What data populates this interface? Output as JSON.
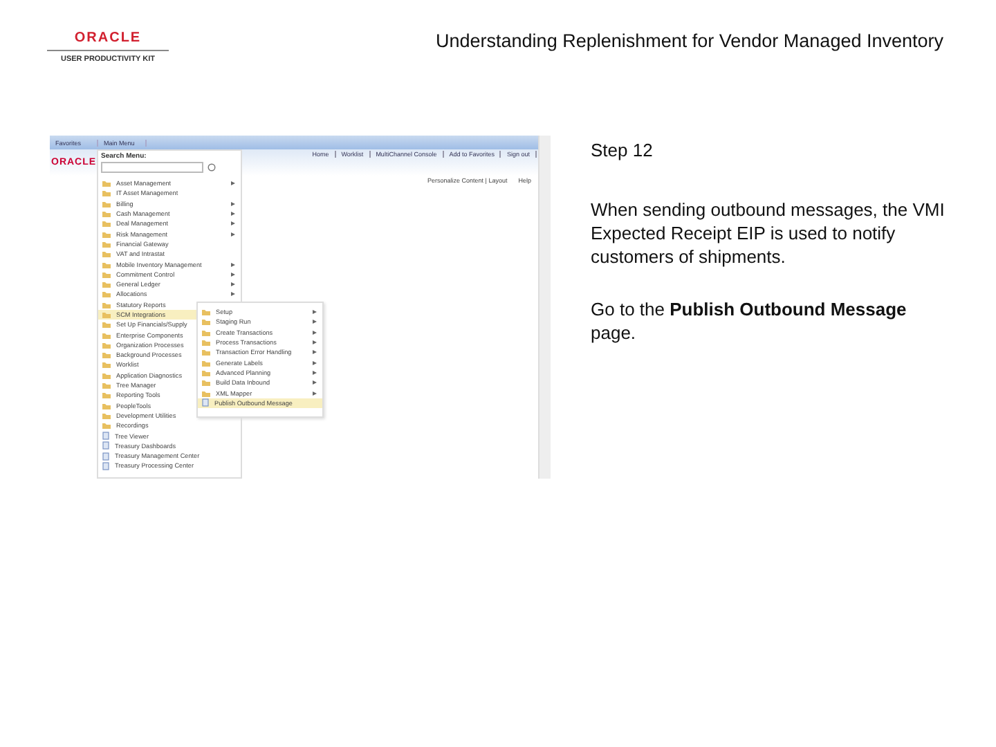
{
  "header": {
    "logo_word": "ORACLE",
    "logo_subtitle": "USER PRODUCTIVITY KIT",
    "title": "Understanding Replenishment for Vendor Managed Inventory"
  },
  "screenshot": {
    "nav": [
      {
        "label": "Favorites"
      },
      {
        "label": "Main Menu"
      }
    ],
    "brand": "ORACLE",
    "top_links": [
      "Home",
      "Worklist",
      "MultiChannel Console",
      "Add to Favorites",
      "Sign out"
    ],
    "personalize": "Personalize Content | Layout",
    "help": "Help",
    "menu": {
      "search_label": "Search Menu:",
      "items": [
        {
          "label": "Asset Management",
          "kind": "folder",
          "arrow": true,
          "selected": false
        },
        {
          "label": "IT Asset Management",
          "kind": "folder",
          "arrow": false,
          "selected": false
        },
        {
          "label": "Billing",
          "kind": "folder",
          "arrow": true,
          "selected": false
        },
        {
          "label": "Cash Management",
          "kind": "folder",
          "arrow": true,
          "selected": false
        },
        {
          "label": "Deal Management",
          "kind": "folder",
          "arrow": true,
          "selected": false
        },
        {
          "label": "Risk Management",
          "kind": "folder",
          "arrow": true,
          "selected": false
        },
        {
          "label": "Financial Gateway",
          "kind": "folder",
          "arrow": false,
          "selected": false
        },
        {
          "label": "VAT and Intrastat",
          "kind": "folder",
          "arrow": false,
          "selected": false
        },
        {
          "label": "Mobile Inventory Management",
          "kind": "folder",
          "arrow": true,
          "selected": false
        },
        {
          "label": "Commitment Control",
          "kind": "folder",
          "arrow": true,
          "selected": false
        },
        {
          "label": "General Ledger",
          "kind": "folder",
          "arrow": true,
          "selected": false
        },
        {
          "label": "Allocations",
          "kind": "folder",
          "arrow": true,
          "selected": false
        },
        {
          "label": "Statutory Reports",
          "kind": "folder",
          "arrow": false,
          "selected": false
        },
        {
          "label": "SCM Integrations",
          "kind": "folder",
          "arrow": false,
          "selected": true
        },
        {
          "label": "Set Up Financials/Supply",
          "kind": "folder",
          "arrow": false,
          "selected": false
        },
        {
          "label": "Enterprise Components",
          "kind": "folder",
          "arrow": false,
          "selected": false
        },
        {
          "label": "Organization Processes",
          "kind": "folder",
          "arrow": false,
          "selected": false
        },
        {
          "label": "Background Processes",
          "kind": "folder",
          "arrow": false,
          "selected": false
        },
        {
          "label": "Worklist",
          "kind": "folder",
          "arrow": false,
          "selected": false
        },
        {
          "label": "Application Diagnostics",
          "kind": "folder",
          "arrow": false,
          "selected": false
        },
        {
          "label": "Tree Manager",
          "kind": "folder",
          "arrow": false,
          "selected": false
        },
        {
          "label": "Reporting Tools",
          "kind": "folder",
          "arrow": false,
          "selected": false
        },
        {
          "label": "PeopleTools",
          "kind": "folder",
          "arrow": false,
          "selected": false
        },
        {
          "label": "Development Utilities",
          "kind": "folder",
          "arrow": false,
          "selected": false
        },
        {
          "label": "Recordings",
          "kind": "folder",
          "arrow": false,
          "selected": false
        },
        {
          "label": "Tree Viewer",
          "kind": "page",
          "arrow": false,
          "selected": false
        },
        {
          "label": "Treasury Dashboards",
          "kind": "page",
          "arrow": false,
          "selected": false
        },
        {
          "label": "Treasury Management Center",
          "kind": "page",
          "arrow": false,
          "selected": false
        },
        {
          "label": "Treasury Processing Center",
          "kind": "page",
          "arrow": false,
          "selected": false
        }
      ]
    },
    "submenu": {
      "items": [
        {
          "label": "Setup",
          "kind": "folder",
          "arrow": true,
          "selected": false
        },
        {
          "label": "Staging Run",
          "kind": "folder",
          "arrow": true,
          "selected": false
        },
        {
          "label": "Create Transactions",
          "kind": "folder",
          "arrow": true,
          "selected": false
        },
        {
          "label": "Process Transactions",
          "kind": "folder",
          "arrow": true,
          "selected": false
        },
        {
          "label": "Transaction Error Handling",
          "kind": "folder",
          "arrow": true,
          "selected": false
        },
        {
          "label": "Generate Labels",
          "kind": "folder",
          "arrow": true,
          "selected": false
        },
        {
          "label": "Advanced Planning",
          "kind": "folder",
          "arrow": true,
          "selected": false
        },
        {
          "label": "Build Data Inbound",
          "kind": "folder",
          "arrow": true,
          "selected": false
        },
        {
          "label": "XML Mapper",
          "kind": "folder",
          "arrow": true,
          "selected": false
        },
        {
          "label": "Publish Outbound Message",
          "kind": "page",
          "arrow": false,
          "selected": true
        }
      ]
    }
  },
  "instructions": {
    "step": "Step 12",
    "paragraphs": [
      "When sending outbound messages, the VMI Expected Receipt EIP is used to notify customers of shipments.",
      "Go to the **Publish Outbound Message** page."
    ]
  }
}
